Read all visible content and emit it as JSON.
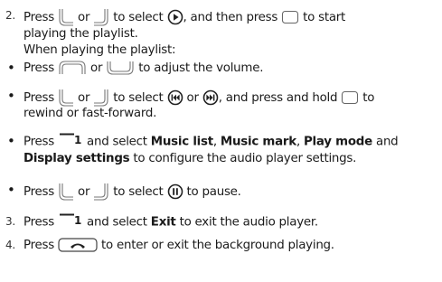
{
  "step2": {
    "number": "2.",
    "press": "Press",
    "or": "or",
    "to_select": "to select",
    "then_press": ", and then press",
    "to_start": "to start",
    "line2": "playing the playlist.",
    "line3": "When playing the playlist:"
  },
  "bullet1": {
    "press": "Press",
    "or": "or",
    "rest": "to adjust the volume."
  },
  "bullet2": {
    "press": "Press",
    "or": "or",
    "to_select": "to select",
    "or2": "or",
    "and_press": ", and press and hold",
    "to": "to",
    "line2": "rewind or fast-forward."
  },
  "bullet3": {
    "press": "Press",
    "key_label": "1",
    "and_select": "and select",
    "music_list": "Music list",
    "comma1": ",",
    "music_mark": "Music mark",
    "comma2": ",",
    "play_mode": "Play mode",
    "and": "and",
    "display_settings": "Display settings",
    "line2_rest": "to configure the audio player settings."
  },
  "bullet4": {
    "press": "Press",
    "or": "or",
    "to_select": "to select",
    "to_pause": "to pause."
  },
  "step3": {
    "number": "3.",
    "press": "Press",
    "key_label": "1",
    "and_select": "and select",
    "exit": "Exit",
    "rest": "to exit the audio player."
  },
  "step4": {
    "number": "4.",
    "press": "Press",
    "rest": "to enter or exit the background playing."
  }
}
